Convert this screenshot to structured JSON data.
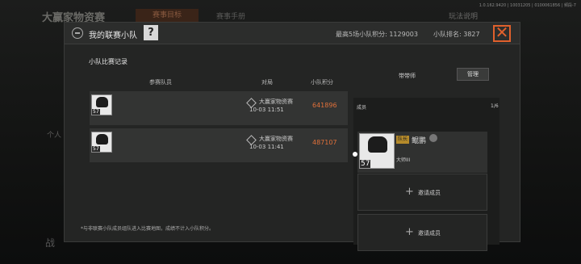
{
  "background": {
    "title": "大赢家物资赛",
    "tab_active": "赛事目标",
    "tab_other": "赛事手册",
    "rules": "玩法说明",
    "version": "1.0.162.9420 | 10031205 | 0100061856 | 频段-7",
    "side_text": "个人",
    "bottom_text": "战"
  },
  "header": {
    "title": "我的联赛小队",
    "help": "?",
    "best_score_label": "最高5场小队积分:",
    "best_score_value": "1129003",
    "rank_label": "小队排名:",
    "rank_value": "3827",
    "close": "✕"
  },
  "records": {
    "section_title": "小队比赛记录",
    "col_team": "参赛队员",
    "col_match": "对局",
    "col_score": "小队积分",
    "rows": [
      {
        "level": "57",
        "mode": "大赢家物资赛",
        "time": "10-03 11:51",
        "score": "641896"
      },
      {
        "level": "57",
        "mode": "大赢家物资赛",
        "time": "10-03 11:41",
        "score": "487107"
      }
    ],
    "note": "*与非联赛小队成员组队进入比赛地图，成绩不计入小队积分。"
  },
  "members": {
    "leader_label": "带带师",
    "manage_button": "管理",
    "label": "成员",
    "count": "1/6",
    "list": [
      {
        "captain_tag": "队长",
        "name": "鲲鹏",
        "level": "57",
        "rank": "大师III"
      }
    ],
    "invite_label": "邀请成员",
    "plus_icon": "+"
  },
  "colors": {
    "accent": "#e0602c",
    "score": "#e0703a",
    "captain": "#b58a2a"
  }
}
